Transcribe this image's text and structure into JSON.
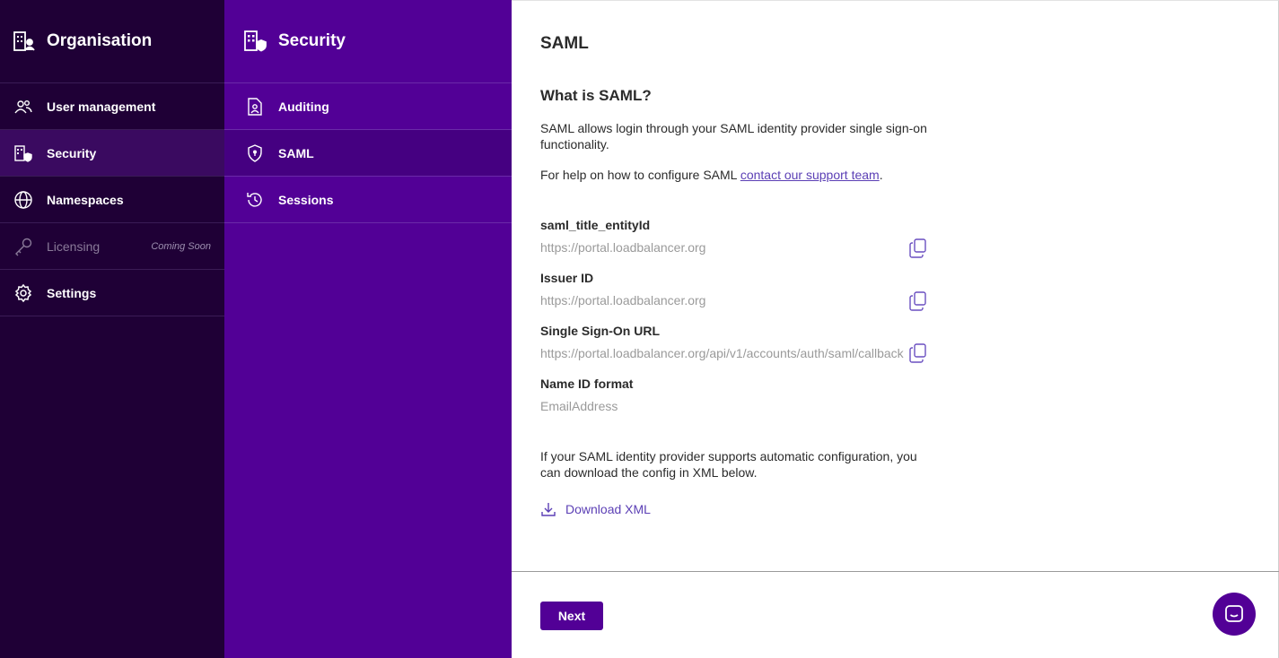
{
  "sidebar": {
    "title": "Organisation",
    "title_icon": "organisation-icon",
    "items": [
      {
        "label": "User management",
        "icon": "users-icon"
      },
      {
        "label": "Security",
        "icon": "security-icon"
      },
      {
        "label": "Namespaces",
        "icon": "globe-icon"
      },
      {
        "label": "Licensing",
        "icon": "key-icon",
        "badge": "Coming Soon"
      },
      {
        "label": "Settings",
        "icon": "gear-icon"
      }
    ]
  },
  "panel": {
    "title": "Security",
    "title_icon": "security-icon",
    "items": [
      {
        "label": "Auditing",
        "icon": "auditing-icon"
      },
      {
        "label": "SAML",
        "icon": "shield-icon"
      },
      {
        "label": "Sessions",
        "icon": "history-icon"
      }
    ]
  },
  "main": {
    "page_title": "SAML",
    "section_title": "What is SAML?",
    "intro": "SAML allows login through your SAML identity provider single sign-on functionality.",
    "help_prefix": "For help on how to configure SAML ",
    "help_link": "contact our support team",
    "help_suffix": ".",
    "fields": [
      {
        "label": "saml_title_entityId",
        "value": "https://portal.loadbalancer.org"
      },
      {
        "label": "Issuer ID",
        "value": "https://portal.loadbalancer.org"
      },
      {
        "label": "Single Sign-On URL",
        "value": "https://portal.loadbalancer.org/api/v1/accounts/auth/saml/callback"
      },
      {
        "label": "Name ID format",
        "value": "EmailAddress"
      }
    ],
    "auto_config_text": "If your SAML identity provider supports automatic configuration, you can download the config in XML below.",
    "download_label": "Download XML",
    "next_label": "Next"
  },
  "colors": {
    "sidebar_bg": "#1f0036",
    "panel_bg": "#520096",
    "accent": "#520096",
    "link": "#5b3fb5"
  }
}
